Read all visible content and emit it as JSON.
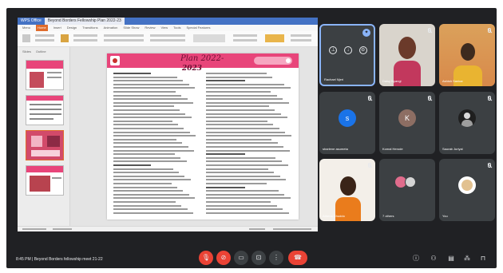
{
  "meeting": {
    "time": "8:45 PM",
    "separator": "|",
    "title": "Beyond Borders fellowship meet 21-22"
  },
  "presentation": {
    "app_tabs": [
      "WPS Office",
      "Beyond Borders Fellowship Plan 2022-23"
    ],
    "menu_items": [
      "Menu",
      "Home",
      "Insert",
      "Design",
      "Transitions",
      "Animation",
      "Slide Show",
      "Review",
      "View",
      "Tools",
      "Special Features"
    ],
    "thumb_tabs": [
      "Slides",
      "Outline"
    ],
    "slide_title": "Plan 2022-",
    "slide_year": "2023"
  },
  "participants": [
    {
      "name": "Rachael Njeri",
      "pinned": true
    },
    {
      "name": "Daisy Nyangi",
      "pinned": false
    },
    {
      "name": "Ashish Sankar",
      "pinned": false
    },
    {
      "name": "sharlene asumeta",
      "initial": "s",
      "color": "#1a73e8"
    },
    {
      "name": "Komal Herode",
      "initial": "K",
      "color": "#8d6e63"
    },
    {
      "name": "Saurab Juriyal",
      "pinned": false
    },
    {
      "name": "Athena Chuddo",
      "pinned": false
    },
    {
      "name": "7 others",
      "pinned": false
    },
    {
      "name": "You",
      "pinned": false
    }
  ],
  "icons": {
    "mic": "mic-icon",
    "camera": "camera-icon",
    "captions": "captions-icon",
    "present": "present-icon",
    "more": "more-vert-icon",
    "end_call": "call-end-icon",
    "info": "info-icon",
    "people": "people-icon",
    "chat": "chat-icon",
    "activities": "activities-icon",
    "host_controls": "lock-icon"
  },
  "colors": {
    "meet_bg": "#202124",
    "tile_bg": "#3c4043",
    "danger": "#ea4335",
    "slide_header": "#e8457a"
  }
}
